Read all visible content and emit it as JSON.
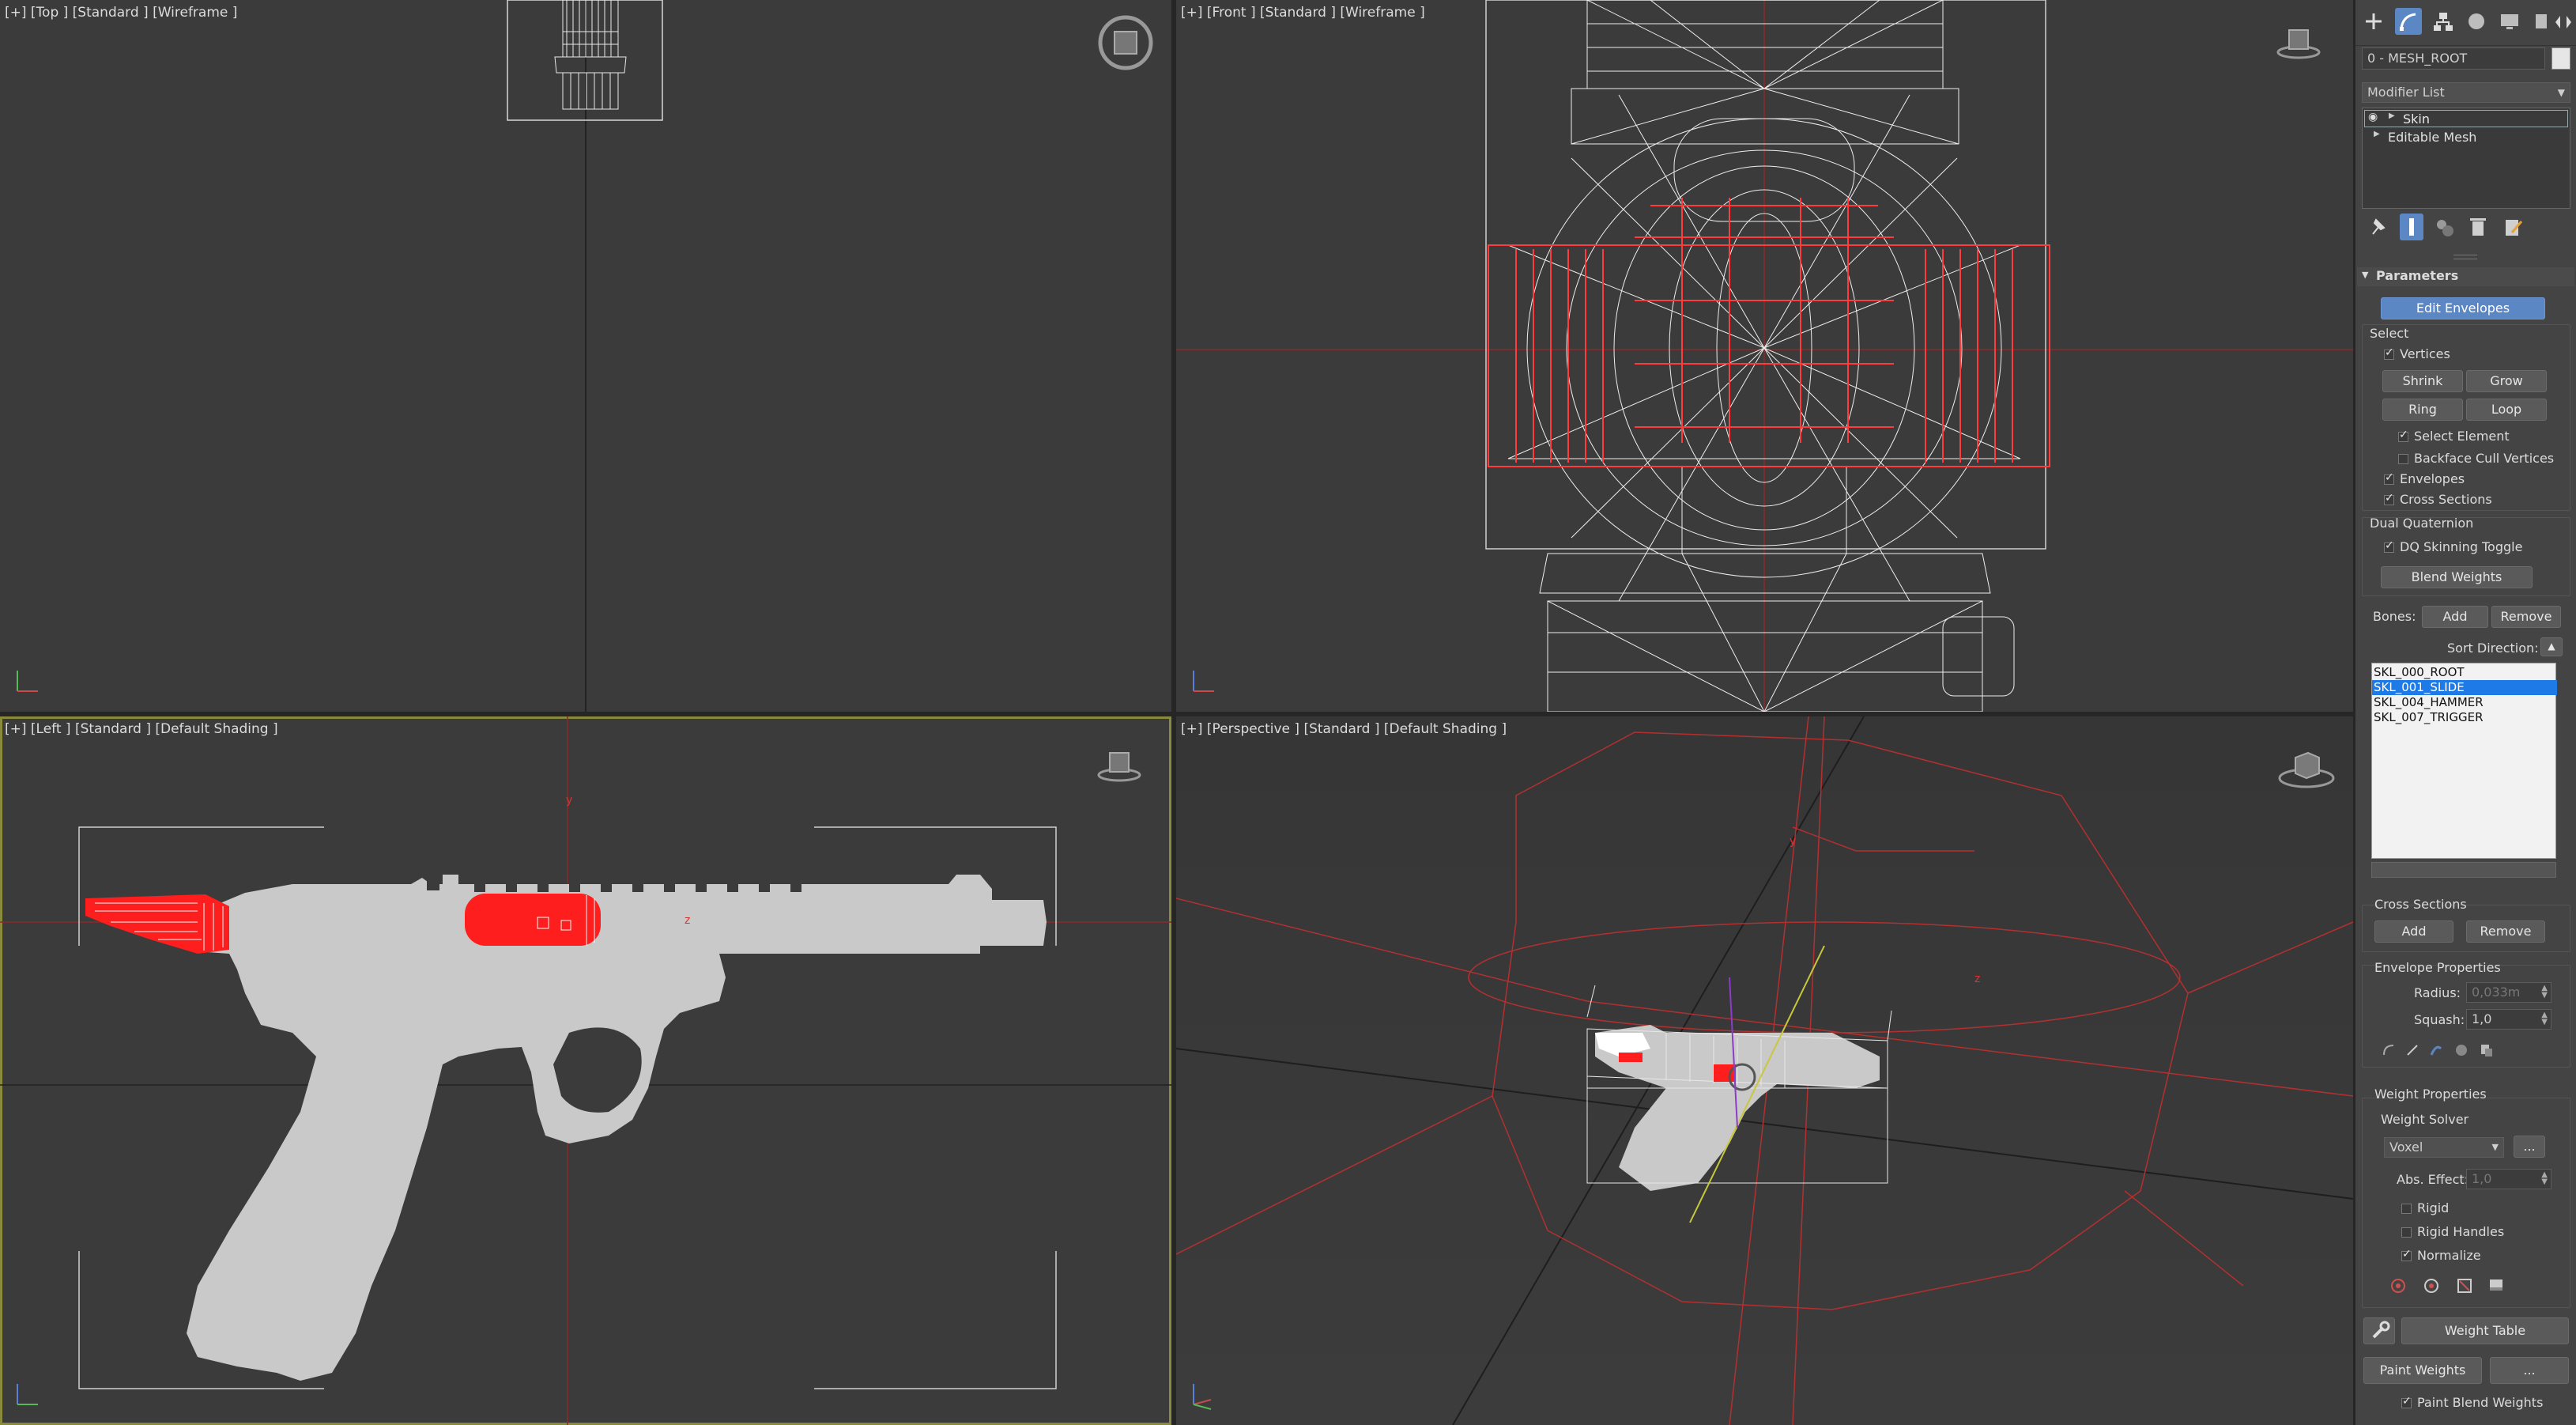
{
  "viewports": {
    "top": {
      "label": "[+] [Top ] [Standard ] [Wireframe ]"
    },
    "front": {
      "label": "[+] [Front ] [Standard ] [Wireframe ]"
    },
    "left": {
      "label": "[+] [Left ] [Standard ] [Default Shading ]"
    },
    "perspective": {
      "label": "[+] [Perspective ] [Standard ] [Default Shading ]"
    }
  },
  "command_panel": {
    "tabs": [
      "create-icon",
      "modify-icon",
      "hierarchy-icon",
      "motion-icon",
      "display-icon",
      "utilities-icon"
    ],
    "object_name": "0 - MESH_ROOT",
    "object_color": "#e6e6e6",
    "modifier_list_label": "Modifier List",
    "stack": [
      {
        "label": "Skin",
        "selected": true
      },
      {
        "label": "Editable Mesh",
        "selected": false
      }
    ],
    "parameters_title": "Parameters",
    "edit_envelopes": "Edit Envelopes",
    "select_title": "Select",
    "vertices": "Vertices",
    "shrink": "Shrink",
    "grow": "Grow",
    "ring": "Ring",
    "loop": "Loop",
    "select_element": "Select Element",
    "backface_cull": "Backface Cull Vertices",
    "envelopes": "Envelopes",
    "cross_sections": "Cross Sections",
    "dual_quaternion": "Dual Quaternion",
    "dq_toggle": "DQ Skinning Toggle",
    "blend_weights": "Blend Weights",
    "bones_label": "Bones:",
    "bones_add": "Add",
    "bones_remove": "Remove",
    "sort_direction": "Sort Direction:",
    "bones": [
      {
        "name": "SKL_000_ROOT",
        "selected": false
      },
      {
        "name": "SKL_001_SLIDE",
        "selected": true
      },
      {
        "name": "SKL_004_HAMMER",
        "selected": false
      },
      {
        "name": "SKL_007_TRIGGER",
        "selected": false
      }
    ],
    "cross_sections_title": "Cross Sections",
    "cs_add": "Add",
    "cs_remove": "Remove",
    "envelope_props_title": "Envelope Properties",
    "radius_label": "Radius:",
    "radius_value": "0,033m",
    "squash_label": "Squash:",
    "squash_value": "1,0",
    "weight_props_title": "Weight Properties",
    "weight_solver": "Weight Solver",
    "solver_value": "Voxel",
    "solver_more": "...",
    "abs_effect_label": "Abs. Effect:",
    "abs_effect_value": "1,0",
    "rigid": "Rigid",
    "rigid_handles": "Rigid Handles",
    "normalize": "Normalize",
    "weight_table": "Weight Table",
    "paint_weights": "Paint Weights",
    "paint_more": "...",
    "paint_blend": "Paint Blend Weights"
  }
}
